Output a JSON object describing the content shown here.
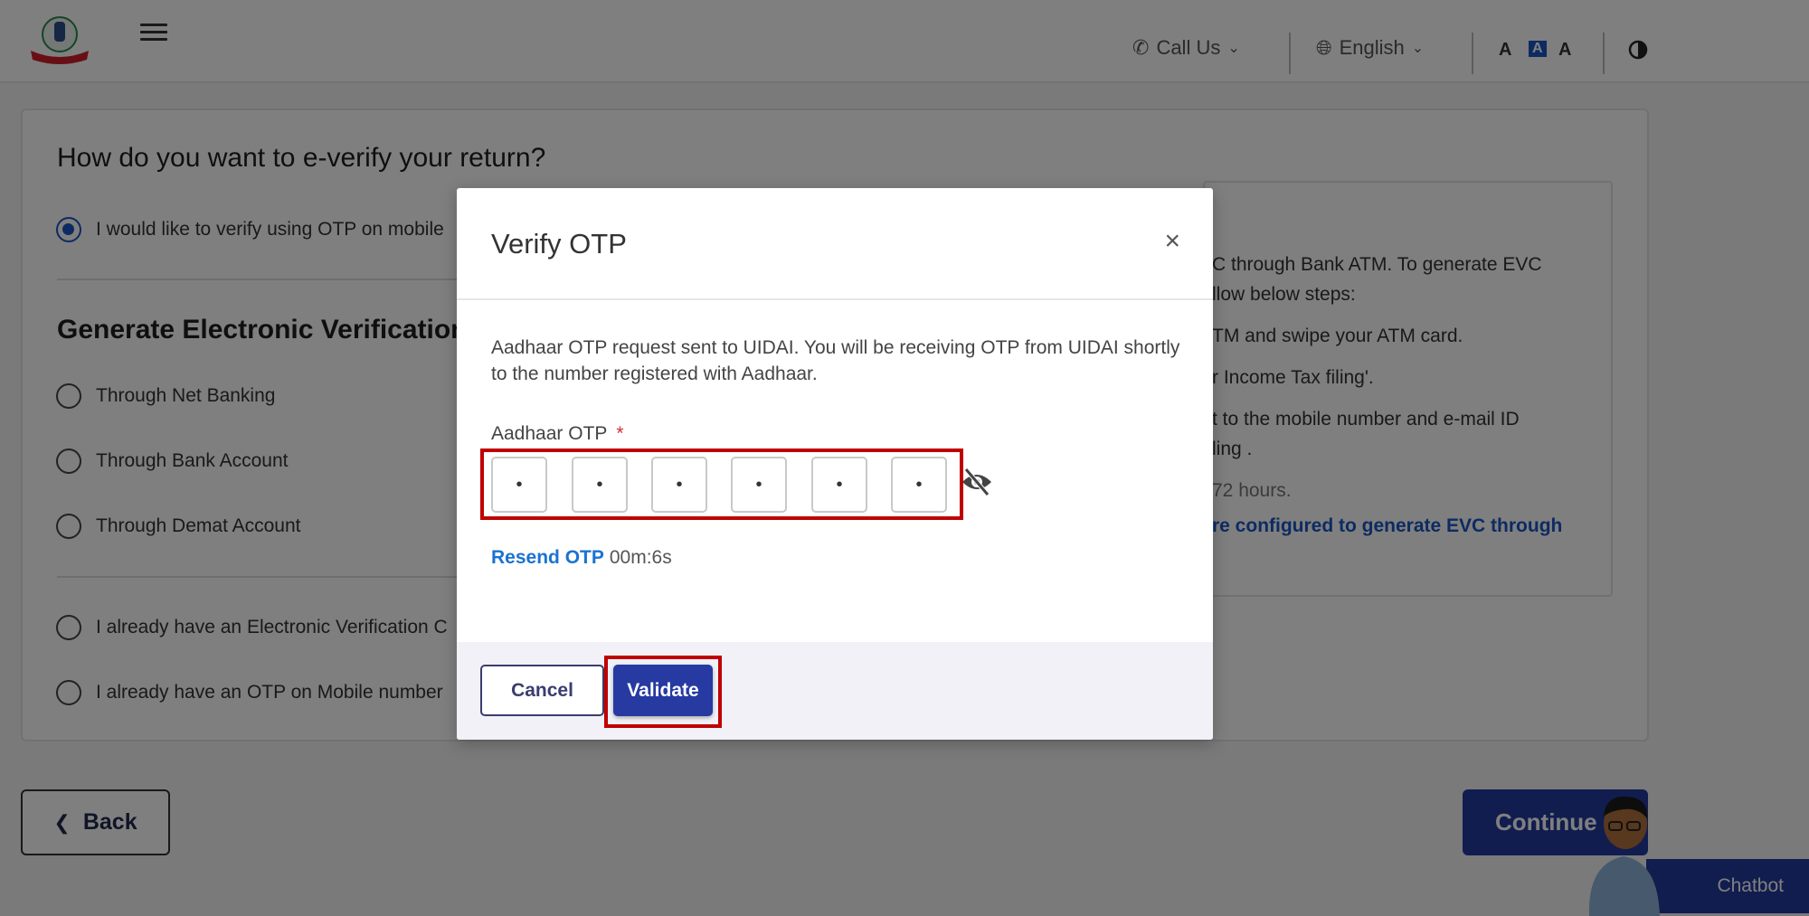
{
  "header": {
    "call_us": "Call Us",
    "language": "English",
    "font_decrease": "A",
    "font_default": "A",
    "font_increase": "A",
    "icons": {
      "logo": "income-tax-department-emblem",
      "menu": "hamburger-icon",
      "phone": "phone-icon",
      "globe": "globe-icon",
      "contrast": "contrast-icon"
    }
  },
  "page": {
    "question": "How do you want to e-verify your return?",
    "option_otp_mobile": "I would like to verify using OTP on mobile",
    "section_title": "Generate Electronic Verification",
    "evc_options": [
      "Through Net Banking",
      "Through Bank Account",
      "Through Demat Account"
    ],
    "option_have_evc": "I already have an Electronic Verification C",
    "option_have_otp": "I already have an OTP on Mobile number",
    "info_lines": [
      "C through Bank ATM. To generate EVC",
      "llow below steps:",
      "TM and swipe your ATM card.",
      "r Income Tax filing'.",
      "t to the mobile number and e-mail ID",
      "ling .",
      "72 hours.",
      "re configured to generate EVC through"
    ],
    "back_label": "Back",
    "continue_label": "Continue",
    "chatbot_label": "Chatbot"
  },
  "modal": {
    "title": "Verify OTP",
    "close": "×",
    "message": "Aadhaar OTP request sent to UIDAI. You will be receiving OTP from UIDAI shortly to the number registered with Aadhaar.",
    "otp_label": "Aadhaar OTP",
    "required_mark": "*",
    "otp_digits": [
      "•",
      "•",
      "•",
      "•",
      "•",
      "•"
    ],
    "resend_label": "Resend OTP",
    "timer": "00m:6s",
    "cancel_label": "Cancel",
    "validate_label": "Validate"
  },
  "colors": {
    "primary": "#263aa2",
    "link": "#1a73d1",
    "highlight": "#c00000",
    "required": "#d32f2f"
  }
}
